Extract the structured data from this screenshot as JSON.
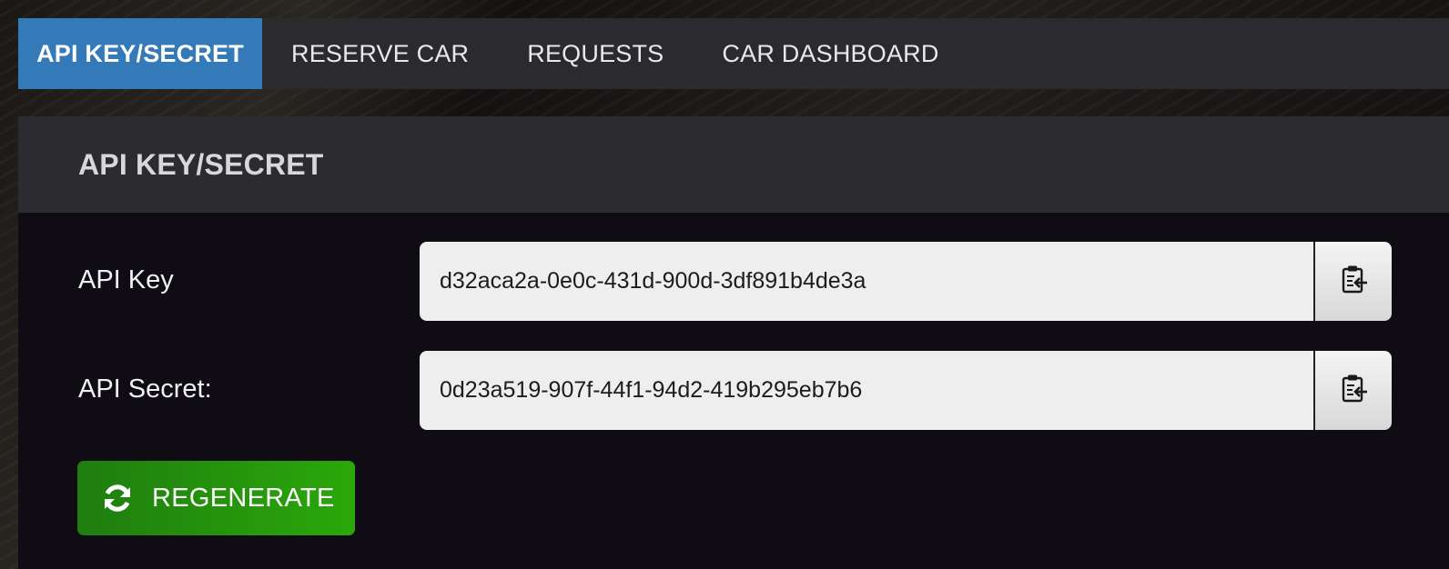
{
  "tabs": [
    {
      "label": "API KEY/SECRET",
      "active": true
    },
    {
      "label": "RESERVE CAR",
      "active": false
    },
    {
      "label": "REQUESTS",
      "active": false
    },
    {
      "label": "CAR DASHBOARD",
      "active": false
    }
  ],
  "panel": {
    "title": "API KEY/SECRET"
  },
  "fields": {
    "api_key": {
      "label": "API Key",
      "value": "d32aca2a-0e0c-431d-900d-3df891b4de3a",
      "copy_icon": "clipboard-copy-icon"
    },
    "api_secret": {
      "label": "API Secret:",
      "value": "0d23a519-907f-44f1-94d2-419b295eb7b6",
      "copy_icon": "clipboard-copy-icon"
    }
  },
  "regenerate_button": {
    "label": "REGENERATE",
    "icon": "refresh-icon"
  },
  "colors": {
    "tab_active": "#347ab9",
    "tab_bar": "#2b2a2f",
    "panel_header": "#2c2b30",
    "panel_body": "#0f0d13",
    "regenerate_start": "#1f7d0f",
    "regenerate_end": "#2aa80a"
  }
}
